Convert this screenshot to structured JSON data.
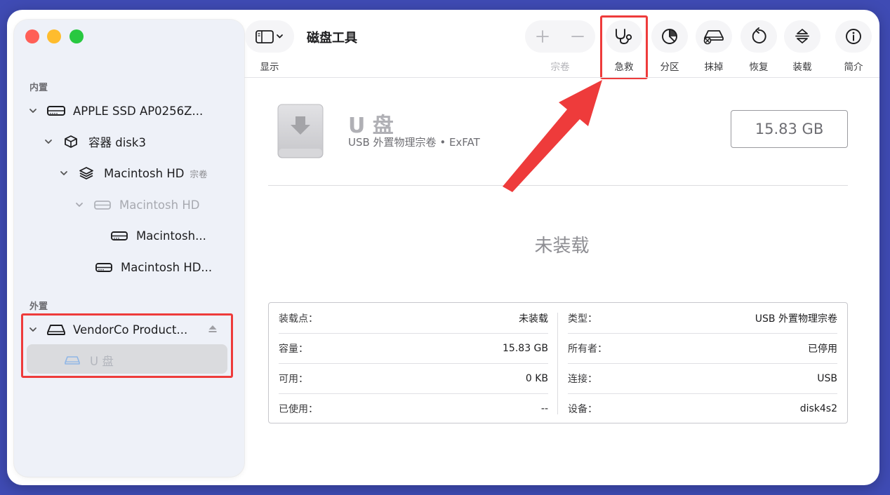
{
  "app": {
    "title": "磁盘工具"
  },
  "sidebar": {
    "sections": {
      "internal": "内置",
      "external": "外置"
    },
    "items": [
      {
        "label": "APPLE SSD AP0256Z..."
      },
      {
        "label": "容器 disk3"
      },
      {
        "label": "Macintosh HD",
        "badge": "宗卷"
      },
      {
        "label": "Macintosh HD"
      },
      {
        "label": "Macintosh..."
      },
      {
        "label": "Macintosh HD..."
      },
      {
        "label": "VendorCo Product..."
      },
      {
        "label": "U 盘"
      }
    ]
  },
  "toolbar": {
    "view_label": "显示",
    "volume_label": "宗卷",
    "first_aid_label": "急救",
    "partition_label": "分区",
    "erase_label": "抹掉",
    "restore_label": "恢复",
    "mount_label": "装载",
    "info_label": "简介"
  },
  "volume": {
    "name": "U 盘",
    "subtitle": "USB 外置物理宗卷 • ExFAT",
    "size": "15.83 GB",
    "status": "未装载"
  },
  "info": {
    "left": [
      {
        "key": "装载点：",
        "value": "未装载"
      },
      {
        "key": "容量：",
        "value": "15.83 GB"
      },
      {
        "key": "可用：",
        "value": "0 KB"
      },
      {
        "key": "已使用：",
        "value": "--"
      }
    ],
    "right": [
      {
        "key": "类型：",
        "value": "USB 外置物理宗卷"
      },
      {
        "key": "所有者：",
        "value": "已停用"
      },
      {
        "key": "连接：",
        "value": "USB"
      },
      {
        "key": "设备：",
        "value": "disk4s2"
      }
    ]
  },
  "colors": {
    "background": "#3f4bb4",
    "annotation_red": "#ee3b3b",
    "sidebar_bg": "#eef1f8"
  }
}
